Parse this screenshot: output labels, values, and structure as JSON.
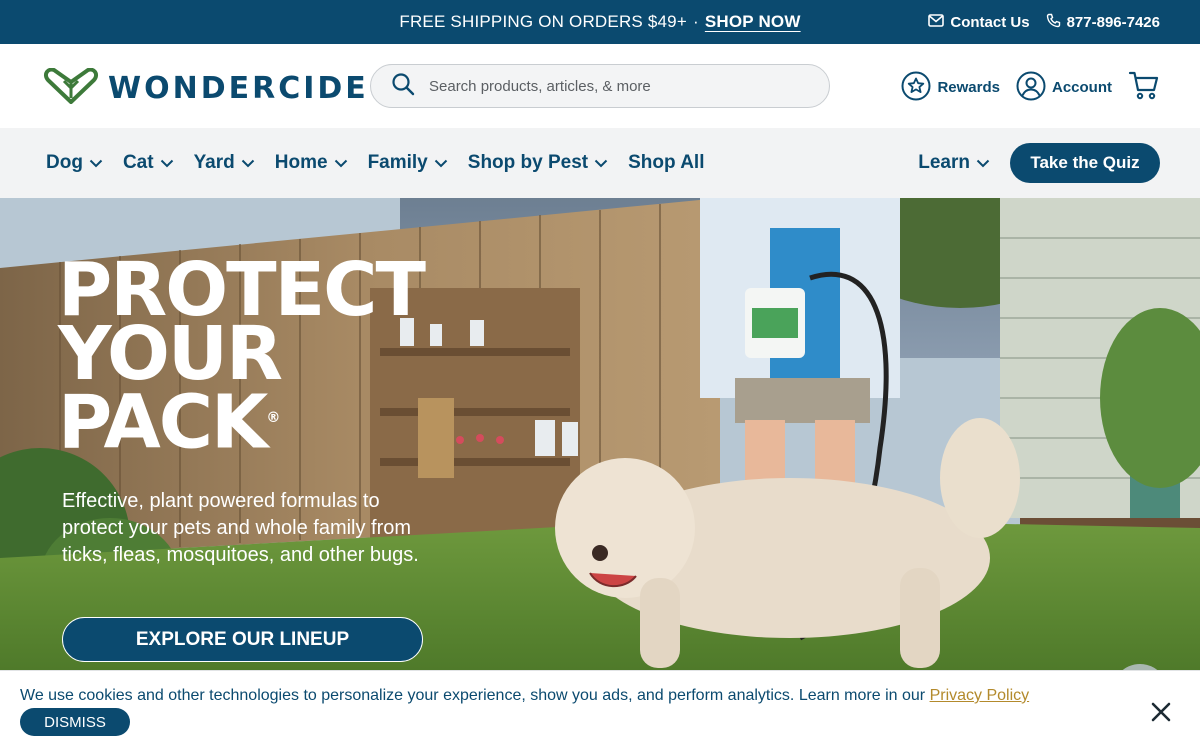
{
  "announcement": {
    "promo_text": "FREE SHIPPING ON ORDERS $49+",
    "separator": "·",
    "promo_link": "SHOP NOW",
    "contact_label": "Contact Us",
    "phone": "877-896-7426"
  },
  "header": {
    "logo_text": "WONDERCIDE",
    "search_placeholder": "Search products, articles, & more",
    "rewards_label": "Rewards",
    "account_label": "Account"
  },
  "nav": {
    "items": [
      {
        "label": "Dog"
      },
      {
        "label": "Cat"
      },
      {
        "label": "Yard"
      },
      {
        "label": "Home"
      },
      {
        "label": "Family"
      },
      {
        "label": "Shop by Pest"
      },
      {
        "label": "Shop All"
      }
    ],
    "learn_label": "Learn",
    "quiz_label": "Take the Quiz"
  },
  "hero": {
    "title_line1": "PROTECT",
    "title_line2": "YOUR",
    "title_line3": "PACK",
    "registered": "®",
    "subtitle": "Effective, plant powered formulas to protect your pets and whole family from ticks, fleas, mosquitoes, and other bugs.",
    "cta_label": "EXPLORE OUR LINEUP"
  },
  "cookie": {
    "message": "We use cookies and other technologies to personalize your experience, show you ads, and perform analytics. Learn more in our",
    "link_label": "Privacy Policy",
    "dismiss_label": "DISMISS"
  },
  "colors": {
    "brand_navy": "#0b4a6f",
    "logo_green": "#3d7a3a",
    "link_gold": "#b38a2c"
  }
}
